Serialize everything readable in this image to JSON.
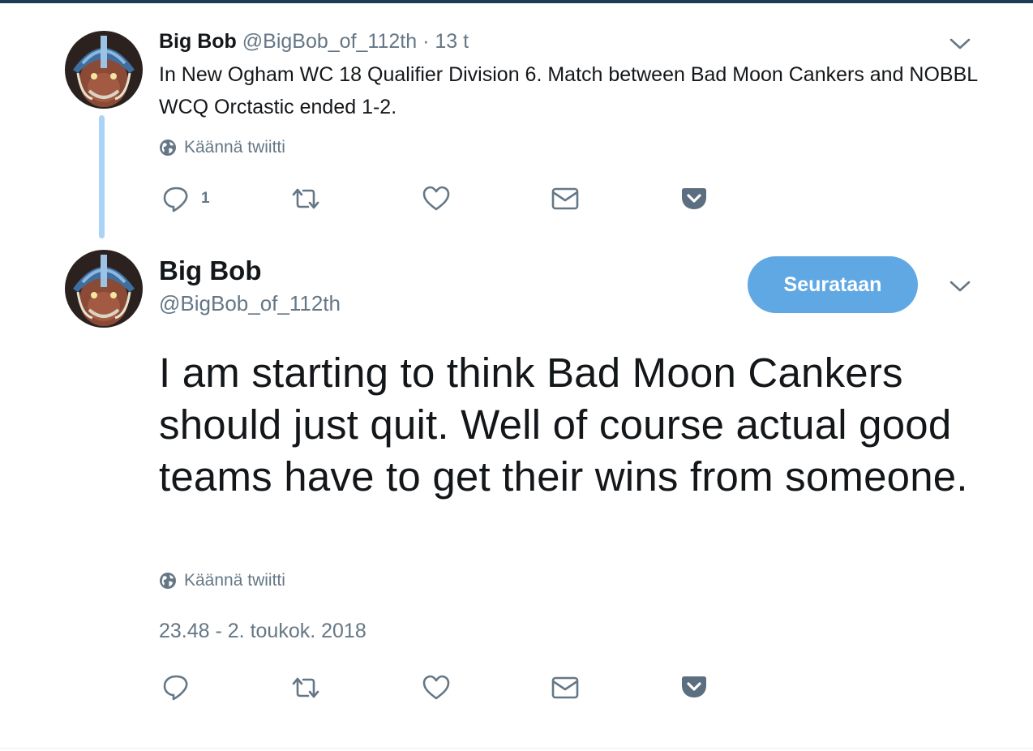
{
  "parent_tweet": {
    "name": "Big Bob",
    "handle": "@BigBob_of_112th",
    "separator": "·",
    "time": "13 t",
    "text": "In New Ogham WC 18 Qualifier Division 6. Match between Bad Moon Cankers and NOBBL WCQ Orctastic ended 1-2.",
    "translate_label": "Käännä twiitti",
    "reply_count": "1",
    "icons": [
      "reply-icon",
      "retweet-icon",
      "like-icon",
      "dm-icon",
      "pocket-icon"
    ]
  },
  "main_tweet": {
    "name": "Big Bob",
    "handle": "@BigBob_of_112th",
    "follow_button": "Seurataan",
    "text": "I am starting to think Bad Moon Cankers should just quit. Well of course actual good teams have to get their wins from someone.",
    "translate_label": "Käännä twiitti",
    "timestamp": "23.48 - 2. toukok. 2018",
    "icons": [
      "reply-icon",
      "retweet-icon",
      "like-icon",
      "dm-icon",
      "pocket-icon"
    ]
  },
  "colors": {
    "accent": "#60a8e4",
    "thread_line": "#a9d4f7",
    "secondary_text": "#657786",
    "icon": "#657786",
    "pocket": "#5b6f80",
    "top_bar": "#1c3b57"
  }
}
